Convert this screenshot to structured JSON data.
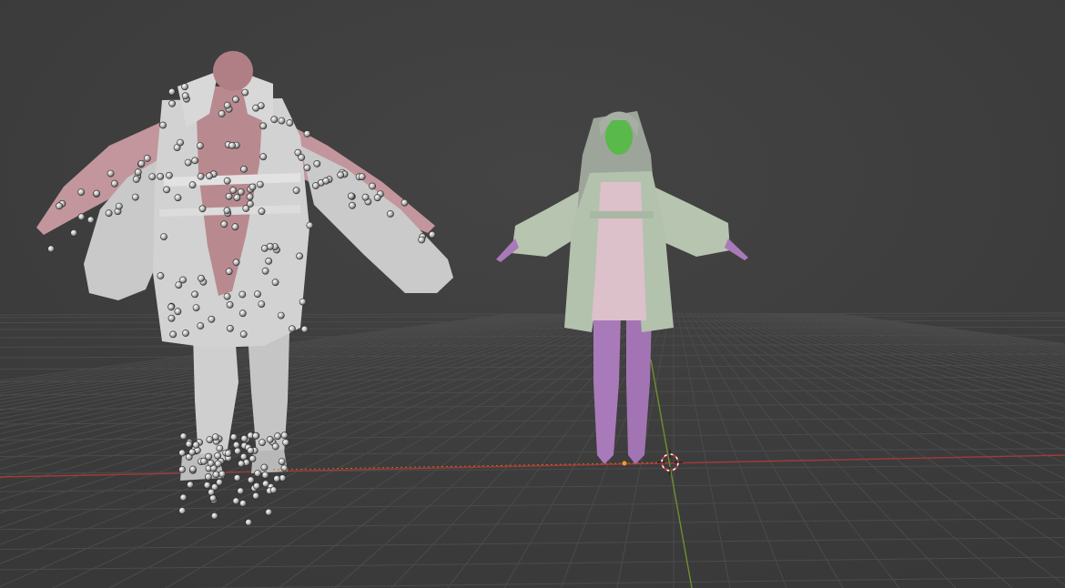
{
  "viewport": {
    "background_color": "#3d3d3d",
    "grid_color": "#484848",
    "x_axis_color": "#b03d3d",
    "y_axis_color": "#6e8f2e"
  },
  "scene": {
    "objects": [
      {
        "name": "rigged-character-with-empties",
        "colors": [
          "#c99aa1",
          "#c8c8c8",
          "#b58085"
        ]
      },
      {
        "name": "anime-girl-character",
        "colors": [
          "#b3c1ad",
          "#d5b8c2",
          "#a978b8",
          "#55b847"
        ]
      }
    ],
    "cursor_icon": "3d-cursor-icon",
    "origin_icon": "object-origin-icon"
  }
}
